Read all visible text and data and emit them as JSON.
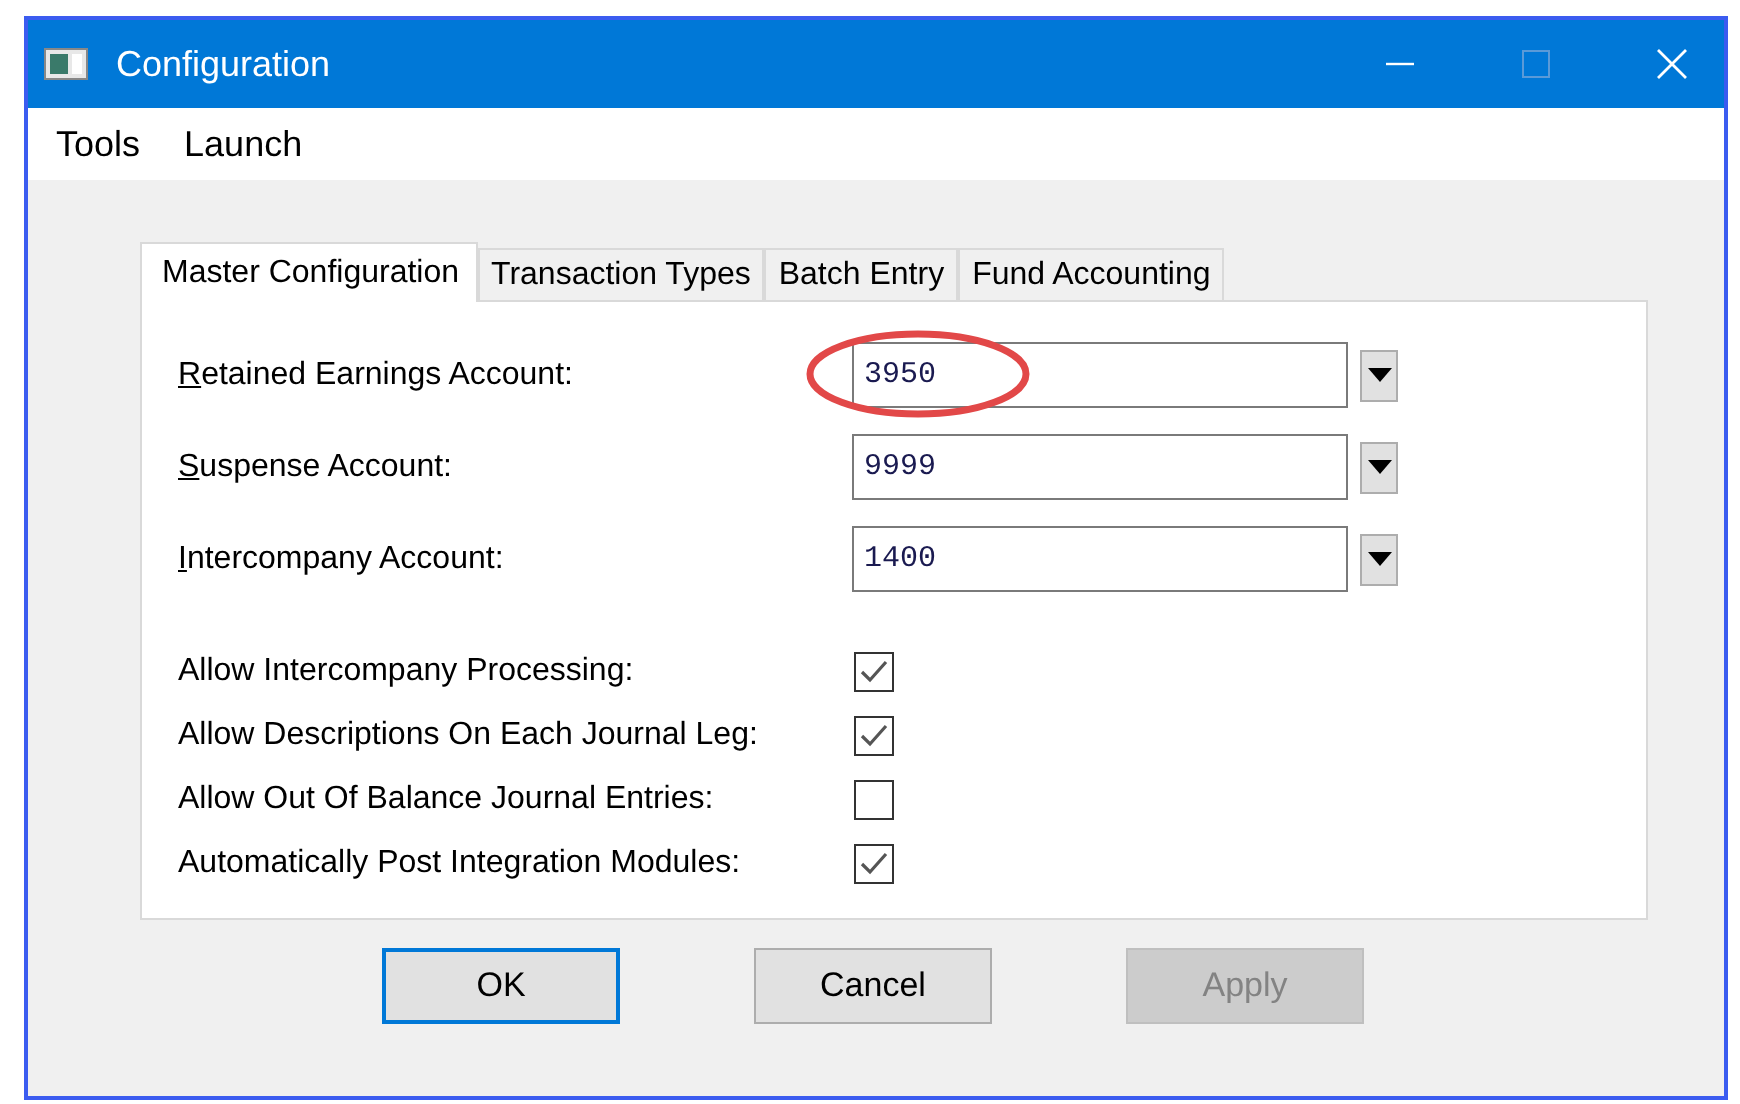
{
  "window": {
    "title": "Configuration"
  },
  "menu": [
    "Tools",
    "Launch"
  ],
  "tabs": [
    {
      "label": "Master Configuration",
      "selected": true
    },
    {
      "label": "Transaction Types",
      "selected": false
    },
    {
      "label": "Batch Entry",
      "selected": false
    },
    {
      "label": "Fund Accounting",
      "selected": false
    }
  ],
  "accounts": [
    {
      "mnemonic": "R",
      "rest": "etained Earnings Account:",
      "value": "3950",
      "highlighted": true
    },
    {
      "mnemonic": "S",
      "rest": "uspense Account:",
      "value": "9999",
      "highlighted": false
    },
    {
      "mnemonic": "I",
      "rest": "ntercompany Account:",
      "value": "1400",
      "highlighted": false
    }
  ],
  "options": [
    {
      "label": "Allow Intercompany Processing:",
      "checked": true
    },
    {
      "label": "Allow Descriptions On Each Journal Leg:",
      "checked": true
    },
    {
      "label": "Allow Out Of Balance Journal Entries:",
      "checked": false
    },
    {
      "label": "Automatically Post Integration Modules:",
      "checked": true
    }
  ],
  "buttons": [
    {
      "label": "OK",
      "default": true,
      "disabled": false
    },
    {
      "label": "Cancel",
      "default": false,
      "disabled": false
    },
    {
      "label": "Apply",
      "default": false,
      "disabled": true
    }
  ]
}
